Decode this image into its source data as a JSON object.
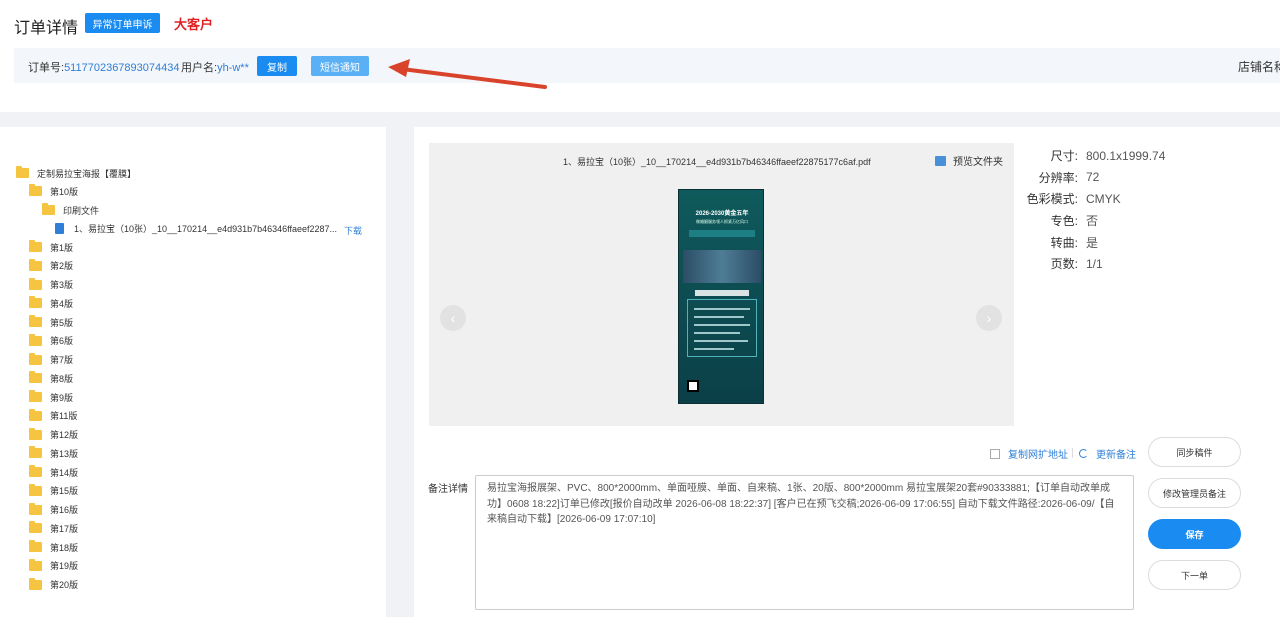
{
  "header": {
    "title": "订单详情",
    "appeal_button": "异常订单申诉",
    "vip_tag": "大客户"
  },
  "order": {
    "order_no_label": "订单号:",
    "order_no": "5117702367893074434",
    "user_label": "用户名:",
    "user": "yh-w**",
    "copy_button": "复制",
    "sms_button": "短信通知",
    "shop_label": "店铺名称"
  },
  "tree": {
    "root": "定制易拉宝海报【覆膜】",
    "versions": [
      "第10版",
      "第1版",
      "第2版",
      "第3版",
      "第4版",
      "第5版",
      "第6版",
      "第7版",
      "第8版",
      "第9版",
      "第11版",
      "第12版",
      "第13版",
      "第14版",
      "第15版",
      "第16版",
      "第17版",
      "第18版",
      "第19版",
      "第20版"
    ],
    "print_folder": "印刷文件",
    "file_name": "1、易拉宝（10张）_10__170214__e4d931b7b46346ffaeef2287...",
    "download": "下载"
  },
  "preview": {
    "file_name": "1、易拉宝（10张）_10__170214__e4d931b7b46346ffaeef22875177c6af.pdf",
    "folder_link": "预览文件夹",
    "prev": "‹",
    "next": "›",
    "poster_title": "2026-2030黄金五年",
    "poster_subtitle": "做婚姻服务领人抓紧万亿风口"
  },
  "specs": [
    {
      "key": "尺寸:",
      "value": "800.1x1999.74"
    },
    {
      "key": "分辨率:",
      "value": "72"
    },
    {
      "key": "色彩模式:",
      "value": "CMYK"
    },
    {
      "key": "专色:",
      "value": "否"
    },
    {
      "key": "转曲:",
      "value": "是"
    },
    {
      "key": "页数:",
      "value": "1/1"
    }
  ],
  "actions": {
    "copy_url": "复制网扩地址",
    "update_remark": "更新备注",
    "sync": "同步稿件",
    "edit_admin_remark": "修改管理员备注",
    "save": "保存",
    "next": "下一单"
  },
  "remark": {
    "label": "备注详情",
    "text": "易拉宝海报展架、PVC、800*2000mm、单面哑膜、单面、自来稿、1张、20版、800*2000mm 易拉宝展架20套#90333881;【订单自动改单成功】0608 18:22]订单已修改[报价自动改单 2026-06-08 18:22:37] [客户已在预飞交稿;2026-06-09 17:06:55] 自动下载文件路径:2026-06-09/【自来稿自动下载】[2026-06-09 17:07:10]"
  },
  "colors": {
    "primary": "#1a8bf0",
    "link": "#2f7fd6",
    "vip": "#e02020",
    "folder": "#f5c542",
    "arrow": "#d9432b"
  }
}
